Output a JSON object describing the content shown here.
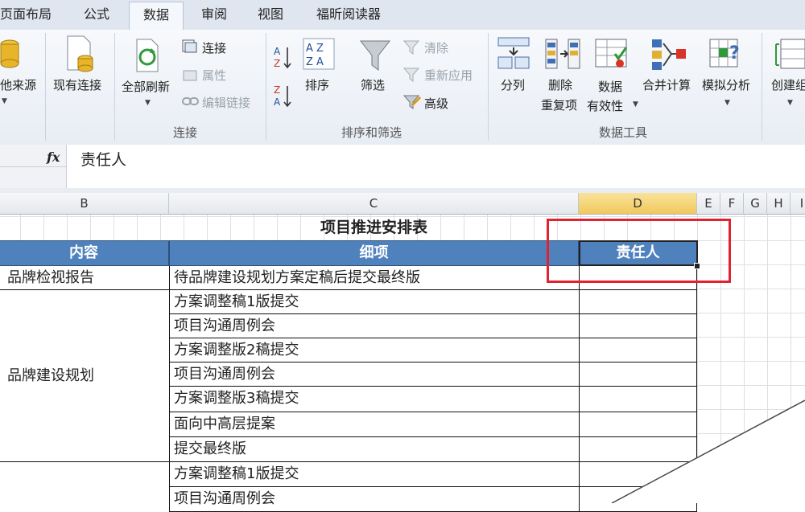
{
  "tabs": [
    {
      "label": "页面布局",
      "active": false
    },
    {
      "label": "公式",
      "active": false
    },
    {
      "label": "数据",
      "active": true
    },
    {
      "label": "审阅",
      "active": false
    },
    {
      "label": "视图",
      "active": false
    },
    {
      "label": "福昕阅读器",
      "active": false
    }
  ],
  "ribbon": {
    "get_data": {
      "other_sources": "他来源",
      "existing_connections": "现有连接"
    },
    "connections": {
      "refresh_all": "全部刷新",
      "connections": "连接",
      "properties": "属性",
      "edit_links": "编辑链接",
      "group_label": "连接"
    },
    "sort_filter": {
      "sort": "排序",
      "filter": "筛选",
      "clear": "清除",
      "reapply": "重新应用",
      "advanced": "高级",
      "group_label": "排序和筛选"
    },
    "data_tools": {
      "text_to_columns": "分列",
      "remove_duplicates_1": "删除",
      "remove_duplicates_2": "重复项",
      "validation_1": "数据",
      "validation_2": "有效性",
      "consolidate": "合并计算",
      "what_if": "模拟分析",
      "group_label": "数据工具"
    },
    "outline": {
      "group": "创建组"
    }
  },
  "formula_bar": {
    "fx_label": "fx",
    "value": "责任人"
  },
  "columns": {
    "B": "B",
    "C": "C",
    "D": "D",
    "E": "E",
    "F": "F",
    "G": "G",
    "H": "H",
    "I": "I"
  },
  "sheet": {
    "title": "项目推进安排表",
    "headers": {
      "content": "内容",
      "detail": "细项",
      "owner": "责任人"
    },
    "groups": [
      {
        "name": "品牌检视报告",
        "items": [
          "待品牌建设规划方案定稿后提交最终版"
        ]
      },
      {
        "name": "品牌建设规划",
        "items": [
          "方案调整稿1版提交",
          "项目沟通周例会",
          "方案调整版2稿提交",
          "项目沟通周例会",
          "方案调整版3稿提交",
          "面向中高层提案",
          "提交最终版"
        ]
      },
      {
        "name": "",
        "items": [
          "方案调整稿1版提交",
          "项目沟通周例会"
        ]
      }
    ]
  },
  "colors": {
    "header_fill": "#4f81bd",
    "selected_col": "#f5d06a",
    "annotation": "#e0232f"
  }
}
